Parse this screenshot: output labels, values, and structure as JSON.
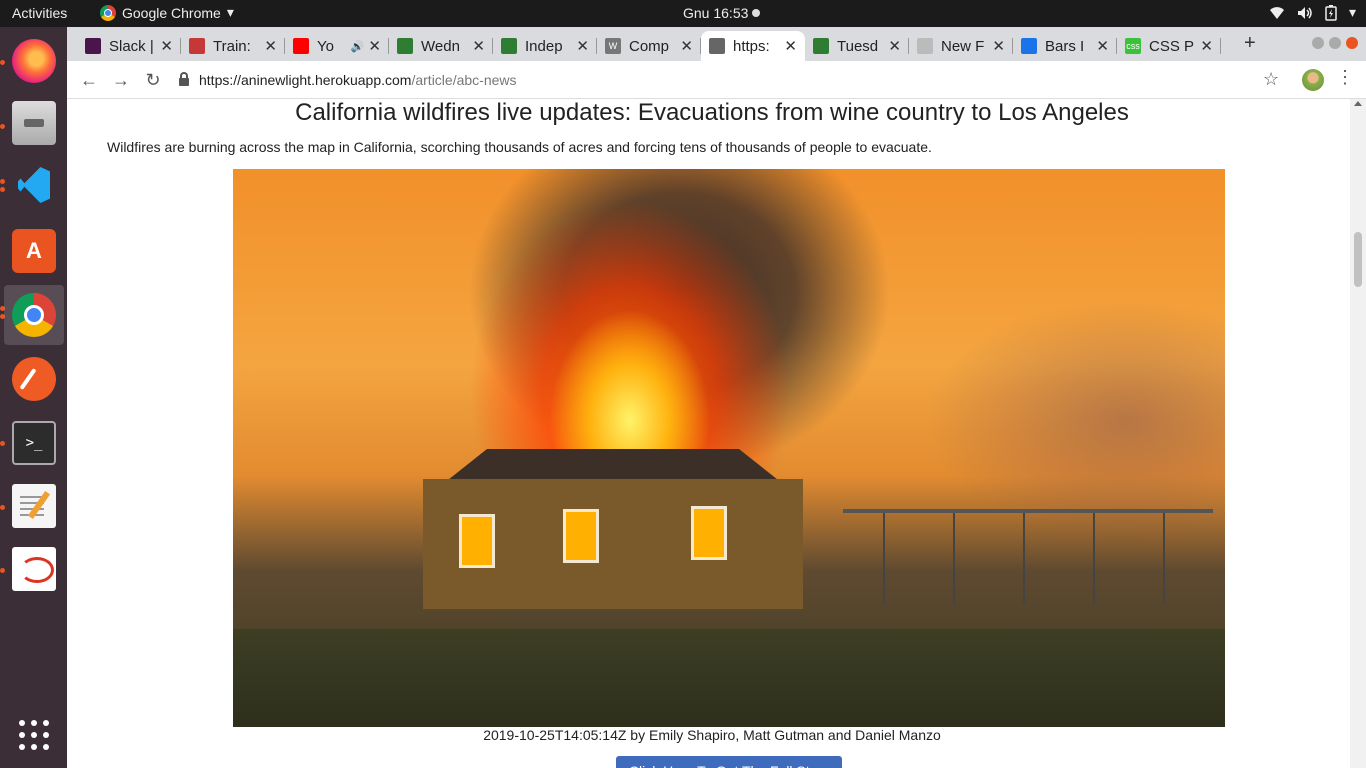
{
  "topbar": {
    "activities": "Activities",
    "app_name": "Google Chrome",
    "app_menu_arrow": "▾",
    "clock": "Gnu 16:53",
    "tray": {
      "wifi": "wifi-icon",
      "volume": "volume-icon",
      "battery": "battery-icon",
      "menu_arrow": "▾"
    }
  },
  "dock": {
    "apps": [
      "firefox",
      "files",
      "visual-studio-code",
      "ubuntu-software",
      "google-chrome",
      "postman",
      "terminal",
      "text-editor",
      "document-viewer",
      "show-applications"
    ]
  },
  "browser": {
    "tabs": [
      {
        "title": "Slack |",
        "icon_color": "#4a154b"
      },
      {
        "title": "Train:",
        "icon_color": "#c63838"
      },
      {
        "title": "Yo",
        "icon_color": "#ff0000",
        "audio": "🔊"
      },
      {
        "title": "Wedn",
        "icon_color": "#2e7d32"
      },
      {
        "title": "Indep",
        "icon_color": "#2e7d32"
      },
      {
        "title": "Comp",
        "icon_color": "#777777",
        "icon_text": "W"
      },
      {
        "title": "https:",
        "icon_color": "#666666",
        "active": true
      },
      {
        "title": "Tuesd",
        "icon_color": "#2e7d32"
      },
      {
        "title": "New F",
        "icon_color": "#bbbbbb"
      },
      {
        "title": "Bars I",
        "icon_color": "#1a73e8"
      },
      {
        "title": "CSS P",
        "icon_color": "#3cc13c",
        "icon_text": "css"
      }
    ],
    "close_glyph": "✕",
    "new_tab_glyph": "+",
    "nav": {
      "back": "←",
      "forward": "→",
      "reload": "↻"
    },
    "url": {
      "host": "https://aninewlight.herokuapp.com",
      "path": "/article/abc-news"
    },
    "star": "☆",
    "menu": "⋮"
  },
  "article": {
    "title": "California wildfires live updates: Evacuations from wine country to Los Angeles",
    "description": "Wildfires are burning across the map in California, scorching thousands of acres and forcing tens of thousands of people to evacuate.",
    "caption": "2019-10-25T14:05:14Z by Emily Shapiro, Matt Gutman and Daniel Manzo",
    "cta": "Click Here To Get The Full Story"
  },
  "colors": {
    "accent": "#3f6bbd",
    "dock": "#3b2e37",
    "topbar": "#1b1b1b",
    "tabstrip": "#dadbdf"
  }
}
